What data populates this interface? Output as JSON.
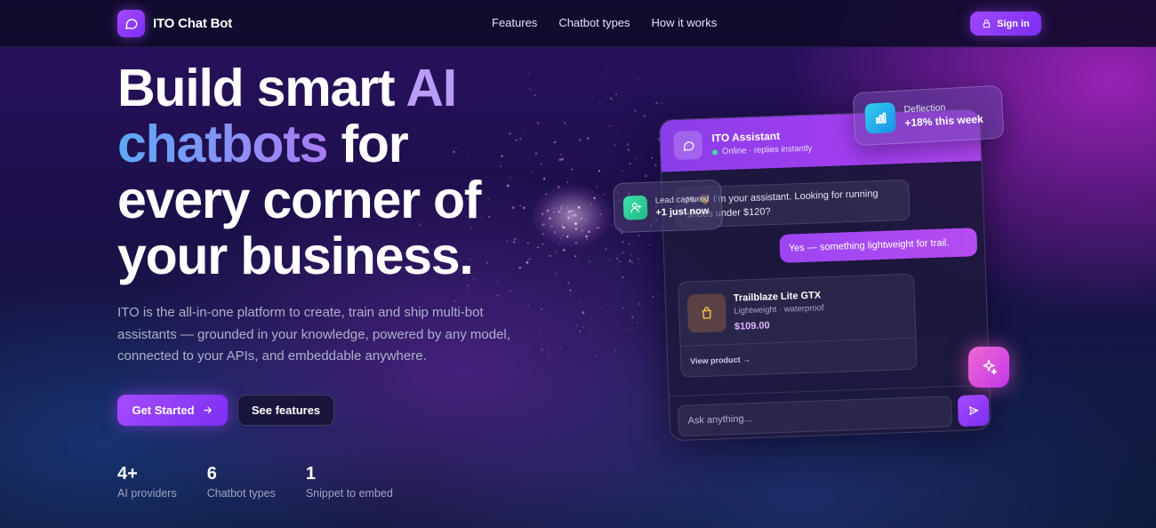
{
  "nav": {
    "brand": "ITO Chat Bot",
    "logo_icon": "chat-bubble-icon",
    "links": [
      "Features",
      "Chatbot types",
      "How it works"
    ],
    "signin_label": "Sign in",
    "signin_icon": "lock-icon"
  },
  "hero": {
    "title_line1_a": "Build smart ",
    "title_line1_b": "AI",
    "title_line2_a": "chatbots",
    "title_line2_b": " for",
    "title_line3": "every corner of",
    "title_line4": "your business.",
    "subtitle": "ITO is the all-in-one platform to create, train and ship multi-bot assistants — grounded in your knowledge, powered by any model, connected to your APIs, and embeddable anywhere.",
    "primary_cta": "Get Started",
    "secondary_cta": "See features"
  },
  "stats": [
    {
      "value": "4+",
      "label": "AI providers"
    },
    {
      "value": "6",
      "label": "Chatbot types"
    },
    {
      "value": "1",
      "label": "Snippet to embed"
    }
  ],
  "chat_preview": {
    "assistant_name": "ITO Assistant",
    "assistant_status": "Online · replies instantly",
    "bot_message": "Hi 👋 I'm your assistant. Looking for running shoes under $120?",
    "user_message": "Yes — something lightweight for trail.",
    "product": {
      "name": "Trailblaze Lite GTX",
      "description": "Lightweight · waterproof",
      "price": "$109.00",
      "link": "View product →"
    },
    "input_placeholder": "Ask anything..."
  },
  "floating": {
    "deflection_label": "Deflection",
    "deflection_value": "+18% this week",
    "lead_label": "Lead captured",
    "lead_value": "+1 just now"
  },
  "colors": {
    "accent": "#a54cff",
    "accent_dark": "#7b2ef2",
    "online": "#3ee0a0",
    "gradient_blue": "#5aa9f5"
  }
}
